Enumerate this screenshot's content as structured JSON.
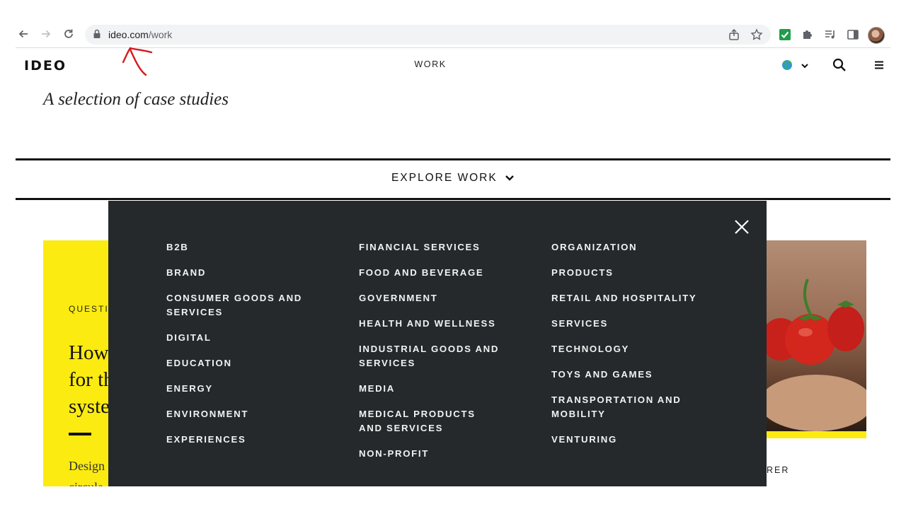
{
  "browser": {
    "url_host": "ideo.com",
    "url_path": "/work",
    "icons": [
      "back-arrow-icon",
      "forward-arrow-icon",
      "reload-icon",
      "lock-icon",
      "share-icon",
      "star-icon",
      "checkbox-extension-icon",
      "puzzle-extension-icon",
      "media-list-icon",
      "side-panel-icon",
      "profile-avatar"
    ]
  },
  "header": {
    "logo": "IDEO",
    "section": "WORK",
    "icons": [
      "globe-icon",
      "chevron-down-icon",
      "search-icon",
      "menu-icon"
    ]
  },
  "intro": "A selection of case studies",
  "explore": {
    "label": "EXPLORE WORK"
  },
  "background_card": {
    "eyebrow": "QUESTIO",
    "title_lines": [
      "How",
      "for th",
      "syste"
    ],
    "desc_lines": [
      "Design",
      "circula"
    ]
  },
  "right_card": {
    "caption_fragment": "RER"
  },
  "menu": {
    "col1": [
      "B2B",
      "BRAND",
      "CONSUMER GOODS AND SERVICES",
      "DIGITAL",
      "EDUCATION",
      "ENERGY",
      "ENVIRONMENT",
      "EXPERIENCES"
    ],
    "col2": [
      "FINANCIAL SERVICES",
      "FOOD AND BEVERAGE",
      "GOVERNMENT",
      "HEALTH AND WELLNESS",
      "INDUSTRIAL GOODS AND SERVICES",
      "MEDIA",
      "MEDICAL PRODUCTS AND SERVICES",
      "NON-PROFIT"
    ],
    "col3": [
      "ORGANIZATION",
      "PRODUCTS",
      "RETAIL AND HOSPITALITY",
      "SERVICES",
      "TECHNOLOGY",
      "TOYS AND GAMES",
      "TRANSPORTATION AND MOBILITY",
      "VENTURING"
    ]
  },
  "colors": {
    "accent_yellow": "#fbeb10",
    "overlay_bg": "#25292c",
    "annotation_red": "#d7191c"
  }
}
